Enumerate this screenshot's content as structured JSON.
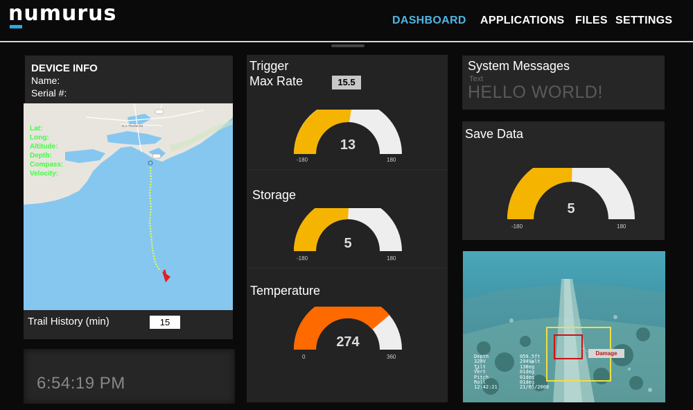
{
  "brand": {
    "logo": "numurus",
    "accent": "#29a8e0"
  },
  "nav": [
    {
      "label": "DASHBOARD",
      "active": true
    },
    {
      "label": "APPLICATIONS",
      "active": false
    },
    {
      "label": "FILES",
      "active": false
    },
    {
      "label": "SETTINGS",
      "active": false
    }
  ],
  "device_info": {
    "title": "DEVICE INFO",
    "name_label": "Name:",
    "serial_label": "Serial #:",
    "map_fields": [
      "Lat:",
      "Long:",
      "Altitude:",
      "Depth:",
      "Compass:",
      "Velocity:"
    ],
    "map_road_label": "N.J. Thorfal Rd",
    "trail_label": "Trail History (min)",
    "trail_value": "15"
  },
  "clock": {
    "time": "6:54:19 PM"
  },
  "gauges": {
    "trigger": {
      "title_line1": "Trigger",
      "title_line2": "Max Rate",
      "rate_value": "15.5",
      "value": "13",
      "min": "-180",
      "max": "180",
      "color": "#f5b400"
    },
    "storage": {
      "title": "Storage",
      "value": "5",
      "min": "-180",
      "max": "180",
      "color": "#f5b400"
    },
    "temperature": {
      "title": "Temperature",
      "value": "274",
      "min": "0",
      "max": "360",
      "color": "#ff6a00"
    },
    "save_data": {
      "title": "Save Data",
      "value": "5",
      "min": "-180",
      "max": "180",
      "color": "#f5b400"
    }
  },
  "system_messages": {
    "title": "System Messages",
    "sublabel": "Text",
    "message": "HELLO WORLD!"
  },
  "video": {
    "damage_label": "Damage",
    "osd_left": "Depth\n320V\nTilt\nVert\nPitch\nRoll\n12:42:21",
    "osd_right": "059.5ft\n294Volt\n138eg\n01deg\n01deg\n01deg\n21/05/2008"
  }
}
